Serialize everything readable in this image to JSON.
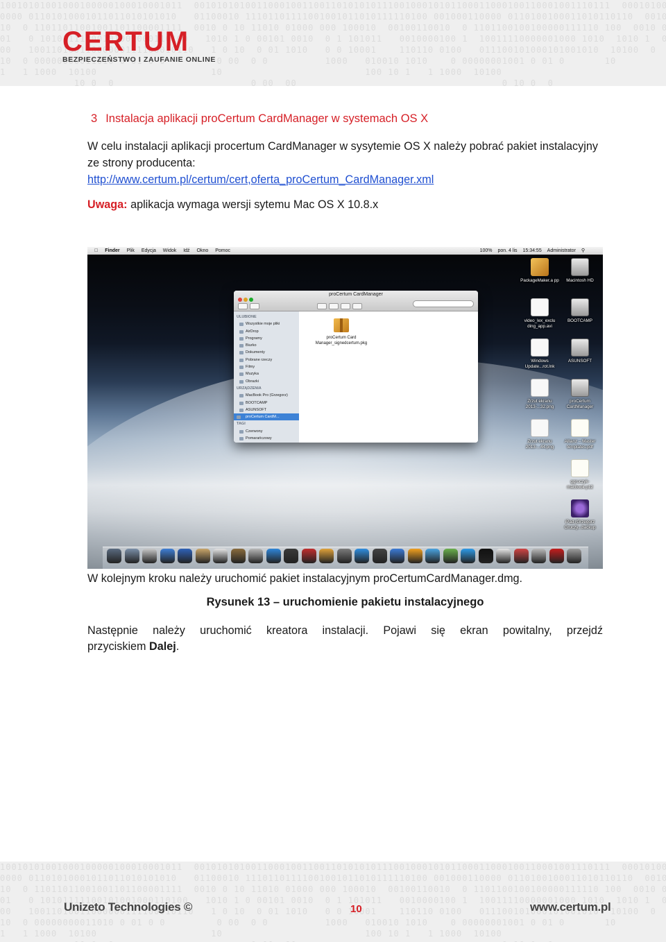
{
  "header": {
    "brand": "CERTUM",
    "tagline": "BEZPIECZEŃSTWO I ZAUFANIE ONLINE",
    "binary_rows": [
      "10010101001000100000100010001011  0010101010011000100110011010101011100100010101100011000100110001001110111  00010100  1100",
      "0000 01101010001011011010101010   01100010 11101101111001001011010111110100 001000110000 0110100100011010110110  0010010 11",
      "10  0 11011011001001101100001111  0010 0 10 11010 01000 000 100010  00100110010  0 1101100100100000111110 100  0010 0 10",
      "01   0 10101111100101001000110100   1010 1 0 00101 0010  0 1 101011   0010000100 1  10011110000001000 1010  1010 1  0",
      "00   10011010011000000111100010110   1 0 10  0 01 1010   0 0 10001    110110 0100   011100101000101001010  10100  0",
      "10  0 00000000011010 0 01 0 0         0 00  0 0          1000   010010 1010    0 00000001001 0 01 0       10",
      "1   1 1000  10100                    10                         100 10 1   1 1000  10100",
      "             10 0  0                        0 00  00                                    0 10 0  0"
    ]
  },
  "section": {
    "number": "3",
    "title": "Instalacja aplikacji proCertum CardManager w systemach OS X"
  },
  "body": {
    "p1": "W celu instalacji aplikacji procertum CardManager w sysytemie OS X należy pobrać pakiet instalacyjny ze strony producenta:",
    "link": "http://www.certum.pl/certum/cert,oferta_proCertum_CardManager.xml",
    "note_label": "Uwaga:",
    "note_text": " aplikacja wymaga wersji sytemu Mac OS X 10.8.x",
    "p2": "W kolejnym kroku należy uruchomić pakiet instalacyjnym proCertumCardManager.dmg.",
    "caption": "Rysunek 13 – uruchomienie pakietu instalacyjnego",
    "p3": "Następnie należy uruchomić kreatora instalacji. Pojawi się ekran powitalny, przejdź",
    "p4_prefix": "przyciskiem ",
    "p4_bold": "Dalej",
    "p4_suffix": "."
  },
  "screenshot": {
    "menubar": {
      "items": [
        "Finder",
        "Plik",
        "Edycja",
        "Widok",
        "Idź",
        "Okno",
        "Pomoc"
      ],
      "status": [
        "100%",
        "pon. 4 lis",
        "15:34:55",
        "Administrator"
      ]
    },
    "finder": {
      "title": "proCertum CardManager",
      "sidebar_sections": [
        {
          "heading": "ULUBIONE",
          "items": [
            "Wszystkie moje pliki",
            "AirDrop",
            "Programy",
            "Biurko",
            "Dokumenty",
            "Pobrane rzeczy",
            "Filmy",
            "Muzyka",
            "Obrazki"
          ]
        },
        {
          "heading": "URZĄDZENIA",
          "items": [
            "MacBook Pro (Grzegorz)",
            "BOOTCAMP",
            "ASUNSOFT",
            "proCertum CardM..."
          ]
        },
        {
          "heading": "TAGI",
          "items": [
            "Czerwony",
            "Pomarańczowy"
          ]
        }
      ],
      "selected_item": "proCertum CardM...",
      "file": {
        "name": "proCertum Card Manager_signedcertum.pkg"
      }
    },
    "desktop_icons": [
      {
        "label": "PackageMaker.a pp",
        "icon": "package-icon"
      },
      {
        "label": "Macintosh HD",
        "icon": "drive-icon"
      },
      {
        "label": "video_lex_exclu ding_app.avi",
        "icon": "file-icon"
      },
      {
        "label": "BOOTCAMP",
        "icon": "drive-icon"
      },
      {
        "label": "Windows Update...rot.lnk",
        "icon": "file-icon"
      },
      {
        "label": "ASUNSOFT",
        "icon": "drive-icon"
      },
      {
        "label": "Zrzut ekranu 2013-...32.png",
        "icon": "file-icon"
      },
      {
        "label": "proCertum CardManager",
        "icon": "drive-icon"
      },
      {
        "label": "Zrzut ekranu 2013-...44.png",
        "icon": "file-icon"
      },
      {
        "label": "Allianz – Master templates.pdf",
        "icon": "document-icon"
      },
      {
        "label": "ggruczyk-macbook.p12",
        "icon": "certificate-icon"
      },
      {
        "label": "iPad (Grzegorz Gruczy...backup",
        "icon": "backup-icon"
      }
    ]
  },
  "footer": {
    "company": "Unizeto Technologies ©",
    "page": "10",
    "site": "www.certum.pl"
  },
  "colors": {
    "accent": "#d61f26",
    "link": "#1f4fd1",
    "band": "#efefef"
  }
}
